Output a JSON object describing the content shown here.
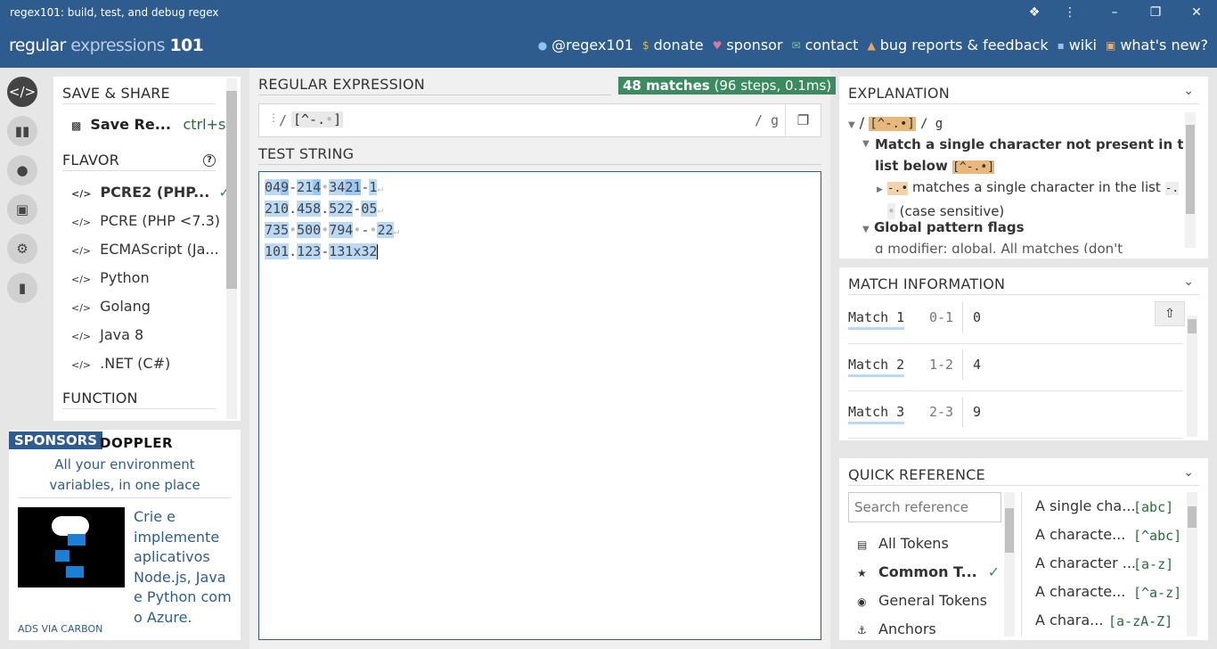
{
  "window": {
    "title": "regex101: build, test, and debug regex",
    "controls": [
      "puzzle-icon",
      "more-icon",
      "minimize-icon",
      "maximize-icon",
      "close-icon"
    ]
  },
  "header": {
    "logo_bold": "regular",
    "logo_light": "expressions",
    "logo_num": "101",
    "nav": [
      {
        "label": "@regex101",
        "icon": "twitter-icon"
      },
      {
        "label": "donate",
        "icon": "dollar-icon"
      },
      {
        "label": "sponsor",
        "icon": "heart-icon"
      },
      {
        "label": "contact",
        "icon": "mail-icon"
      },
      {
        "label": "bug reports & feedback",
        "icon": "warning-icon"
      },
      {
        "label": "wiki",
        "icon": "chat-icon"
      },
      {
        "label": "what's new?",
        "icon": "book-icon"
      }
    ]
  },
  "rail": [
    "code-icon",
    "library-icon",
    "user-icon",
    "controller-icon",
    "gear-icon",
    "comments-icon"
  ],
  "sidebar": {
    "save_heading": "SAVE & SHARE",
    "save_label": "Save Re...",
    "save_shortcut": "ctrl+s",
    "flavor_heading": "FLAVOR",
    "flavors": [
      "PCRE2 (PHP...",
      "PCRE (PHP <7.3)",
      "ECMAScript (Ja...",
      "Python",
      "Golang",
      "Java 8",
      ".NET (C#)"
    ],
    "function_heading": "FUNCTION"
  },
  "sponsors": {
    "badge": "SPONSORS",
    "brand": "DOPPLER",
    "tagline": "All your environment variables, in one place",
    "ad_text": "Crie e implemente aplicativos Node.js, Java e Python com o Azure.",
    "ads_via": "ADS VIA CARBON"
  },
  "regex": {
    "label": "REGULAR EXPRESSION",
    "match_count": "48 matches",
    "match_detail": "(96 steps, 0.1ms)",
    "delim_open": "/",
    "pattern_open": "[^-.",
    "pattern_close": "]",
    "flags": "/ g"
  },
  "test": {
    "label": "TEST STRING",
    "lines": [
      "049-214 3421-1",
      "210.458.522-05",
      "735 500 794 - 22",
      "101.123-131x32"
    ]
  },
  "explanation": {
    "title": "EXPLANATION",
    "pattern_token": "[^-.•]",
    "flags": "/ g",
    "line1": "Match a single character not present in the",
    "line2": "list below",
    "list_token": "[^-.•]",
    "sub_token": "-.•",
    "sub_text": "matches a single character in the list",
    "sub_code": "-.",
    "case_text": "(case sensitive)",
    "flags_heading": "Global pattern flags",
    "cut_text": "g modifier: global. All matches (don't"
  },
  "match_info": {
    "title": "MATCH INFORMATION",
    "rows": [
      {
        "label": "Match 1",
        "range": "0-1",
        "value": "0"
      },
      {
        "label": "Match 2",
        "range": "1-2",
        "value": "4"
      },
      {
        "label": "Match 3",
        "range": "2-3",
        "value": "9"
      }
    ]
  },
  "quick_ref": {
    "title": "QUICK REFERENCE",
    "search_placeholder": "Search reference",
    "categories": [
      {
        "label": "All Tokens",
        "icon": "stack-icon"
      },
      {
        "label": "Common T...",
        "icon": "star-icon"
      },
      {
        "label": "General Tokens",
        "icon": "circle-dot-icon"
      },
      {
        "label": "Anchors",
        "icon": "anchor-icon"
      }
    ],
    "entries": [
      {
        "label": "A single cha...",
        "code": "[abc]"
      },
      {
        "label": "A characte...",
        "code": "[^abc]"
      },
      {
        "label": "A character ...",
        "code": "[a-z]"
      },
      {
        "label": "A characte...",
        "code": "[^a-z]"
      },
      {
        "label": "A chara...",
        "code": "[a-zA-Z]"
      }
    ]
  },
  "colors": {
    "brand": "#2f5c8f",
    "match_badge": "#3c8a5f",
    "match_highlight": "#b9d9f7",
    "token_highlight": "#e8b77c"
  }
}
